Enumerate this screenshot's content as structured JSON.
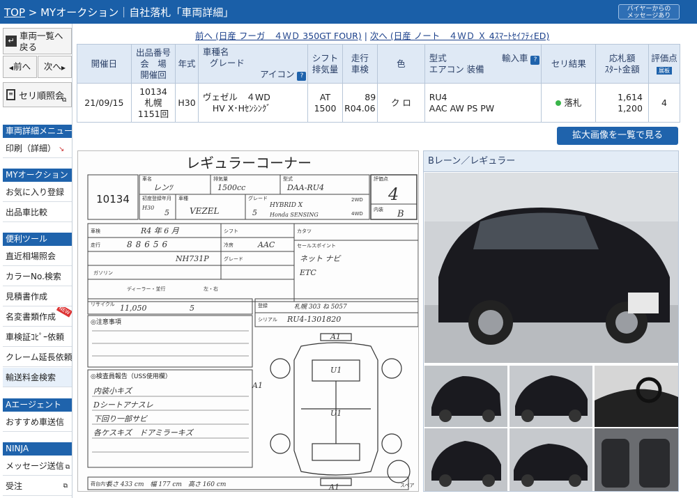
{
  "header": {
    "top_link": "TOP",
    "breadcrumb": " > MYオークション｜自社落札「車両詳細」",
    "buyer_msg_line1": "バイヤーからの",
    "buyer_msg_line2": "メッセージあり"
  },
  "sidebar": {
    "back_label_1": "車両一覧へ",
    "back_label_2": "戻る",
    "prev_label": "前へ",
    "next_label": "次へ",
    "seri_label": "セリ順照会",
    "sections": [
      {
        "title": "車両詳細メニュー",
        "items": [
          "印刷（詳細）"
        ]
      },
      {
        "title": "MYオークション",
        "items": [
          "お気に入り登録",
          "出品車比較"
        ]
      },
      {
        "title": "便利ツール",
        "items": [
          "直近相場照会",
          "カラーNo.検索",
          "見積書作成",
          "名変書類作成",
          "車検証ｺﾋﾟｰ依頼",
          "クレーム延長依頼",
          "輸送料金検索"
        ]
      },
      {
        "title": "Aエージェント",
        "items": [
          "おすすめ車送信"
        ]
      },
      {
        "title": "NINJA",
        "items": [
          "メッセージ送信",
          "受注"
        ]
      }
    ],
    "new_badge": "NEW"
  },
  "nav": {
    "prev": "前へ (日産 フーガ　４ＷＤ 350GT FOUR)",
    "sep": " | ",
    "next": "次へ (日産 ノート　４ＷＤ Ｘ 4ｽﾏｰﾄｾｲﾌﾃｨED)"
  },
  "table": {
    "headers": {
      "date": "開催日",
      "lot_1": "出品番号",
      "lot_2": "会　場",
      "lot_3": "開催回",
      "year": "年式",
      "model_1": "車種名",
      "model_2": "グレード",
      "model_3": "アイコン",
      "shift_1": "シフト",
      "shift_2": "排気量",
      "mileage_1": "走行",
      "mileage_2": "車検",
      "color": "色",
      "type_1": "型式",
      "type_2": "輸入車",
      "type_3": "エアコン 装備",
      "result": "セリ結果",
      "bid_1": "応札額",
      "bid_2": "ｽﾀｰﾄ金額",
      "score": "評価点",
      "score_badge": "展板",
      "help": "?"
    },
    "row": {
      "date": "21/09/15",
      "lot": "10134",
      "venue": "札幌",
      "round": "1151回",
      "year": "H30",
      "model": "ヴェゼル　４WD",
      "grade": "HV X･Hｾﾝｼﾝｸﾞ",
      "shift": "AT",
      "cc": "1500",
      "mileage": "89",
      "inspection": "R04.06",
      "color": "ク ロ",
      "type": "RU4",
      "equip": "AAC AW PS PW",
      "result": "落札",
      "bid": "1,614",
      "start": "1,200",
      "score": "4"
    }
  },
  "enlarge_button": "拡大画像を一覧で見る",
  "photo_panel": {
    "title": "Bレーン／レギュラー"
  },
  "sheet": {
    "title": "レギュラーコーナー",
    "lot": "10134",
    "lbl_shamei": "車名",
    "lbl_haiki": "排気量",
    "lbl_katashiki": "型式",
    "lbl_hyoka": "評価点",
    "lbl_shoudo": "初度登録年月",
    "lbl_shashu": "車種",
    "lbl_grade": "グレード",
    "lbl_2wd": "2WD",
    "lbl_4wd": "4WD",
    "lbl_naiso": "内装",
    "lbl_shaken": "車検",
    "lbl_shift": "シフト",
    "lbl_sokou": "走行",
    "lbl_reibou": "冷房",
    "lbl_katsu": "カタツ",
    "lbl_grade2": "グレード",
    "lbl_sales": "セールスポイント",
    "lbl_gasoline": "ガソリン",
    "lbl_dealer": "ディーラー・並行",
    "lbl_handle": "左・右",
    "lbl_recycle": "リサイクル",
    "lbl_notes": "◎注意事項",
    "lbl_inspector": "◎検査員報告（USS使用欄）",
    "lbl_toroku": "登録",
    "lbl_serial": "シリアル",
    "lbl_nishiki": "荷台内寸",
    "lbl_spare": "スペア",
    "h_maker": "レンﾂ",
    "h_cc": "1500cc",
    "h_type": "DAA-RU4",
    "h_score": "4",
    "h_interior": "B",
    "h_model": "VEZEL",
    "h_year": "H30",
    "h_month": "5",
    "h_doors": "5",
    "h_grade1": "HYBRID X",
    "h_grade2": "Honda SENSING",
    "h_shaken": "R4 年 6 月",
    "h_km": "88656",
    "h_aac": "AAC",
    "h_color": "NH731P",
    "h_sales1": "ネット ナビ",
    "h_sales2": "ETC",
    "h_recycle": "11,050",
    "h_seats": "5",
    "h_reg": "札幌 303 ね 5057",
    "h_serial": "RU4-1301820",
    "h_rep1": "内装小キズ",
    "h_rep2": "Dシートアナスレ",
    "h_rep3": "下回り一部サビ",
    "h_rep4": "各ケスキズ　ドアミラーキズ",
    "h_dim": "長さ 433 cm　幅 177 cm　高さ 160 cm",
    "h_a1": "A1",
    "h_u1": "U1"
  },
  "colors": {
    "header": "#1a5fa8",
    "section": "#1f63ac",
    "table_head": "#dfe9f5",
    "car": "#1a1a1f"
  },
  "icons": [
    "back-icon",
    "print-icon",
    "seri-icon",
    "external-icon",
    "question-icon",
    "green-dot-icon"
  ]
}
